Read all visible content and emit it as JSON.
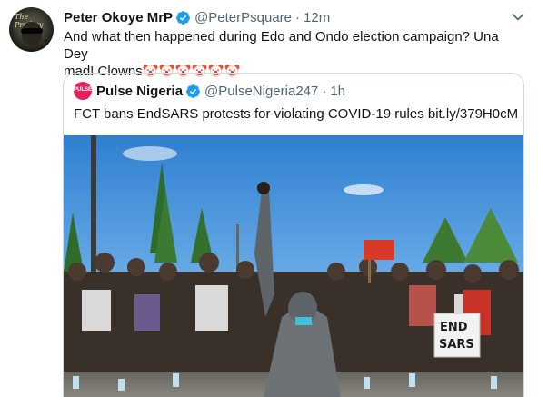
{
  "tweet": {
    "author_name": "Peter Okoye MrP",
    "handle": "@PeterPsquare",
    "separator": "·",
    "time": "12m",
    "avatar_text": "The Prodigy",
    "text_line1": "And what then happened during Edo and Ondo election campaign? Una Dey",
    "text_line2": "mad! Clowns",
    "emojis": [
      "clown-face",
      "clown-face",
      "clown-face",
      "clown-face",
      "clown-face",
      "clown-face"
    ]
  },
  "quoted": {
    "author_name": "Pulse Nigeria",
    "handle": "@PulseNigeria247",
    "separator": "·",
    "time": "1h",
    "avatar_text": "PULSE",
    "text": "FCT bans EndSARS protests for violating COVID-19 rules bit.ly/379H0cM",
    "photo_signs": [
      "END",
      "SARS"
    ]
  },
  "icons": {
    "verified": "verified-badge-icon",
    "more": "chevron-down-icon"
  },
  "colors": {
    "verified_blue": "#1d9bf0",
    "secondary_text": "#536471",
    "border": "#cfd9de"
  }
}
